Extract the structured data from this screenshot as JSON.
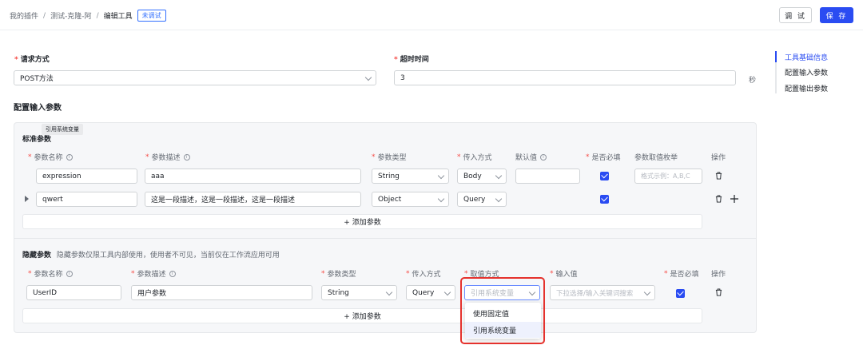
{
  "breadcrumb": {
    "items": [
      "我的插件",
      "测试-克隆-阿",
      "编辑工具"
    ],
    "separator": "/",
    "status_tag": "未调试"
  },
  "header": {
    "debug_label": "调 试",
    "save_label": "保 存"
  },
  "request": {
    "method_label": "请求方式",
    "method_value": "POST方法",
    "timeout_label": "超时时间",
    "timeout_value": "3",
    "timeout_unit": "秒",
    "required_mark": "*"
  },
  "section_title": "配置输入参数",
  "right_nav": {
    "items": [
      "工具基础信息",
      "配置输入参数",
      "配置输出参数"
    ],
    "active_index": 0
  },
  "tooltip": "引用系统变量",
  "standard": {
    "title": "标准参数",
    "headers": {
      "name": "参数名称",
      "desc": "参数描述",
      "type": "参数类型",
      "method": "传入方式",
      "default": "默认值",
      "required": "是否必填",
      "enum": "参数取值枚举",
      "ops": "操作"
    },
    "rows": [
      {
        "name": "expression",
        "desc": "aaa",
        "type": "String",
        "method": "Body",
        "default": "",
        "enum_placeholder": "格式示例：A,B,C",
        "required": true
      },
      {
        "name": "qwert",
        "desc": "这是一段描述，这是一段描述，这是一段描述",
        "type": "Object",
        "method": "Query",
        "required": true
      }
    ],
    "add_label": "+ 添加参数"
  },
  "hidden": {
    "title": "隐藏参数",
    "subtitle": "隐藏参数仅限工具内部使用，使用者不可见，当前仅在工作流应用可用",
    "headers": {
      "name": "参数名称",
      "desc": "参数描述",
      "type": "参数类型",
      "method": "传入方式",
      "value_mode": "取值方式",
      "input_value": "输入值",
      "required": "是否必填",
      "ops": "操作"
    },
    "row": {
      "name": "UserID",
      "desc": "用户参数",
      "type": "String",
      "method": "Query",
      "value_mode_placeholder": "引用系统变量",
      "input_placeholder": "下拉选择/输入关键词搜索",
      "required": true
    },
    "add_label": "+ 添加参数",
    "dropdown_options": [
      "使用固定值",
      "引用系统变量"
    ],
    "dropdown_selected": 1
  },
  "icons": {
    "info": "info-circle-icon",
    "trash": "trash-icon",
    "plus": "plus-icon",
    "chevron": "chevron-down-icon",
    "caret": "caret-right-icon"
  },
  "colors": {
    "accent": "#2a4cf2",
    "required": "#f54a45",
    "highlight_box": "#e5322d"
  }
}
